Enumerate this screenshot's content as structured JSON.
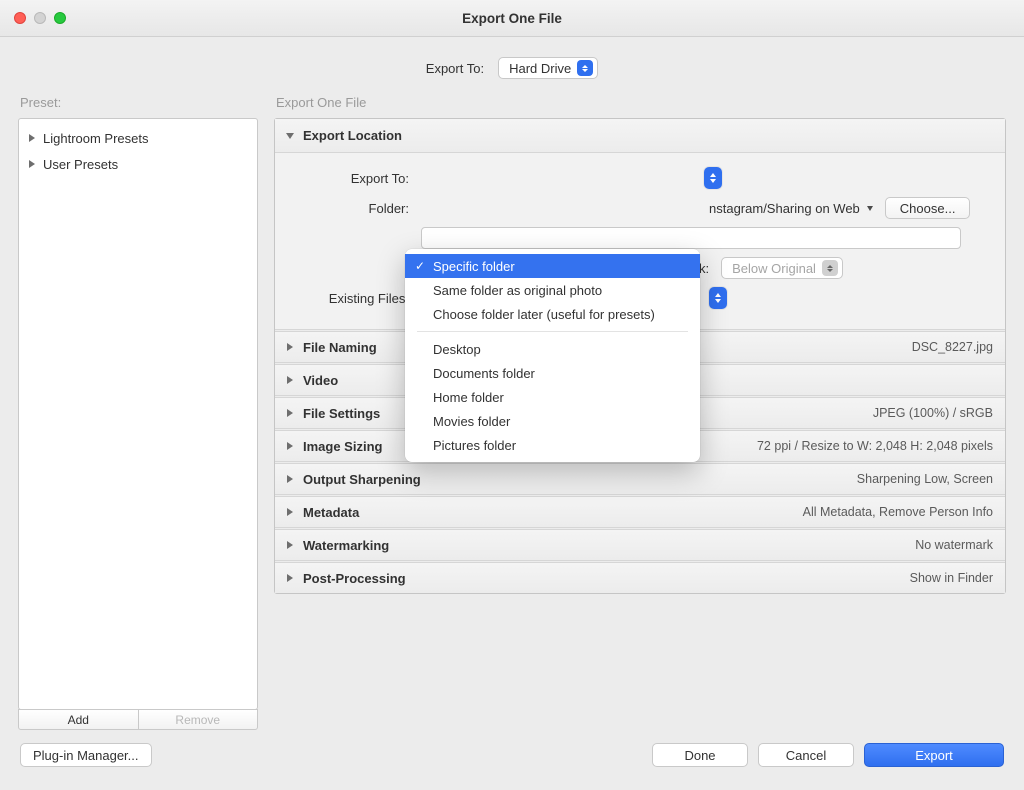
{
  "window_title": "Export One File",
  "toprow": {
    "label": "Export To:",
    "value": "Hard Drive"
  },
  "left": {
    "label": "Preset:",
    "presets": [
      "Lightroom Presets",
      "User Presets"
    ],
    "add": "Add",
    "remove": "Remove"
  },
  "right_label": "Export One File",
  "export_location": {
    "title": "Export Location",
    "export_to_label": "Export To:",
    "folder_label": "Folder:",
    "folder_path_tail": "nstagram/Sharing on Web",
    "choose": "Choose...",
    "stack_label": "k:",
    "stack_value": "Below Original",
    "existing_label": "Existing Files:"
  },
  "dropdown": {
    "selected": "Specific folder",
    "items_a": [
      "Specific folder",
      "Same folder as original photo",
      "Choose folder later (useful for presets)"
    ],
    "items_b": [
      "Desktop",
      "Documents folder",
      "Home folder",
      "Movies folder",
      "Pictures folder"
    ]
  },
  "sections": [
    {
      "title": "File Naming",
      "summary": "DSC_8227.jpg"
    },
    {
      "title": "Video",
      "summary": ""
    },
    {
      "title": "File Settings",
      "summary": "JPEG (100%) / sRGB"
    },
    {
      "title": "Image Sizing",
      "summary": "72 ppi / Resize to W: 2,048 H: 2,048 pixels"
    },
    {
      "title": "Output Sharpening",
      "summary": "Sharpening Low, Screen"
    },
    {
      "title": "Metadata",
      "summary": "All Metadata, Remove Person Info"
    },
    {
      "title": "Watermarking",
      "summary": "No watermark"
    },
    {
      "title": "Post-Processing",
      "summary": "Show in Finder"
    }
  ],
  "footer": {
    "plugin": "Plug-in Manager...",
    "done": "Done",
    "cancel": "Cancel",
    "export": "Export"
  }
}
